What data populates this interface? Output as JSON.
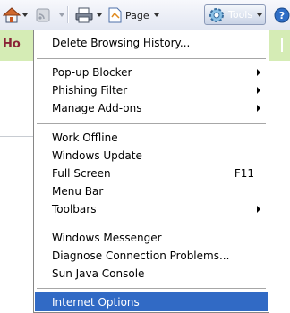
{
  "toolbar": {
    "page_label": "Page",
    "tools_label": "Tools"
  },
  "page": {
    "heading_fragment": "Ho"
  },
  "menu": {
    "items": [
      {
        "label": "Delete Browsing History..."
      },
      {
        "label": "Pop-up Blocker"
      },
      {
        "label": "Phishing Filter"
      },
      {
        "label": "Manage Add-ons"
      },
      {
        "label": "Work Offline"
      },
      {
        "label": "Windows Update"
      },
      {
        "label": "Full Screen",
        "shortcut": "F11"
      },
      {
        "label": "Menu Bar"
      },
      {
        "label": "Toolbars"
      },
      {
        "label": "Windows Messenger"
      },
      {
        "label": "Diagnose Connection Problems..."
      },
      {
        "label": "Sun Java Console"
      },
      {
        "label": "Internet Options"
      }
    ]
  }
}
